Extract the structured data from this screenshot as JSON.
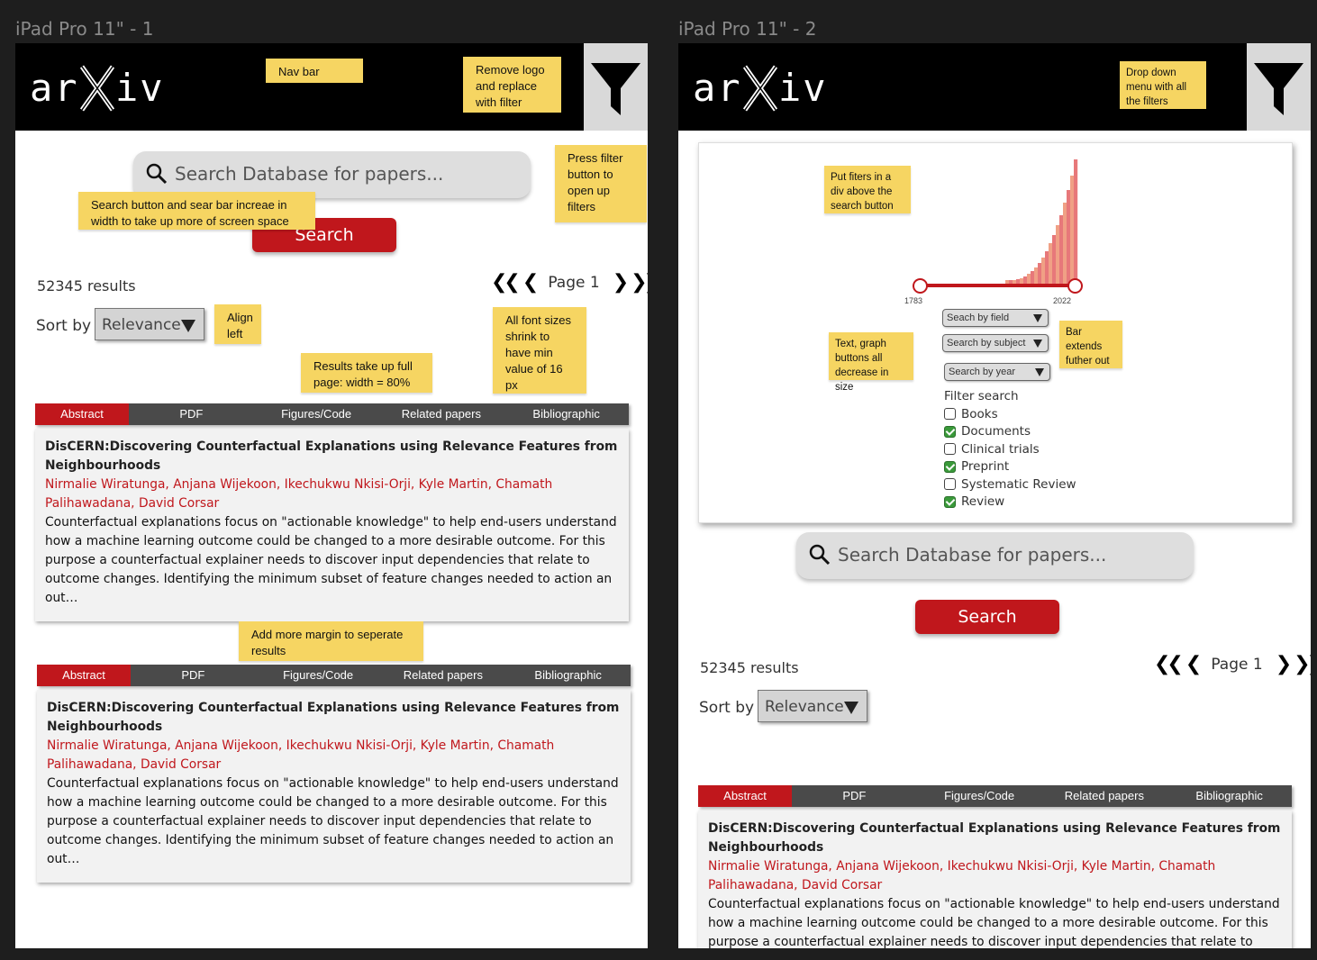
{
  "frames": [
    {
      "label": "iPad Pro 11\" - 1",
      "search": {
        "placeholder": "Search Database for papers...",
        "button": "Search"
      },
      "results_count": "52345 results",
      "pager": {
        "first": "«",
        "prev": "‹",
        "page_label": "Page 1",
        "next": "›",
        "last": "»"
      },
      "sort": {
        "label": "Sort by",
        "value": "Relevance"
      },
      "notes": {
        "nav_bar": "Nav bar",
        "remove_logo": "Remove logo and replace with filter",
        "press_filter": "Press filter button to open up filters",
        "search_width": "Search button and sear bar increae in width to take up more of screen space",
        "align_left": "Align left",
        "results_full": "Results take up full page: width = 80%",
        "font_sizes": "All font sizes shrink to have min value of 16 px",
        "margin": "Add more margin to seperate results"
      }
    },
    {
      "label": "iPad Pro 11\" - 2",
      "search": {
        "placeholder": "Search Database for papers...",
        "button": "Search"
      },
      "results_count": "52345 results",
      "pager": {
        "first": "«",
        "prev": "‹",
        "page_label": "Page 1",
        "next": "›",
        "last": "»"
      },
      "sort": {
        "label": "Sort by",
        "value": "Relevance"
      },
      "notes": {
        "dropdown": "Drop down menu with all the filters",
        "put_filters": "Put fiters in a div above the search button",
        "text_graph": "Text, graph buttons all decrease in size",
        "bar_extends": "Bar extends futher out"
      },
      "filters": {
        "year_min": "1783",
        "year_max": "2022",
        "selects": [
          "Seach by field",
          "Search by subject",
          "Search by year"
        ],
        "filter_header": "Filter search",
        "options": [
          {
            "label": "Books",
            "checked": false
          },
          {
            "label": "Documents",
            "checked": true
          },
          {
            "label": "Clinical trials",
            "checked": false
          },
          {
            "label": "Preprint",
            "checked": true
          },
          {
            "label": "Systematic Review",
            "checked": false
          },
          {
            "label": "Review",
            "checked": true
          }
        ]
      }
    }
  ],
  "tabs": [
    "Abstract",
    "PDF",
    "Figures/Code",
    "Related papers",
    "Bibliographic"
  ],
  "result": {
    "title": "DisCERN:Discovering Counterfactual Explanations using Relevance Features from Neighbourhoods",
    "authors": "Nirmalie Wiratunga, Anjana Wijekoon, Ikechukwu Nkisi-Orji, Kyle Martin, Chamath Palihawadana, David Corsar",
    "abstract": "Counterfactual explanations focus on \"actionable knowledge\" to help end-users understand how a machine learning outcome could be changed to a more desirable outcome. For this purpose a counterfactual explainer needs to discover input dependencies that relate to outcome changes. Identifying the minimum subset of feature changes needed to action an out…"
  },
  "icons": {
    "logo": "arxiv-logo",
    "filter": "funnel-icon",
    "search": "magnifier-icon"
  },
  "colors": {
    "accent": "#c0171c",
    "note": "#f6d562",
    "nav": "#000000",
    "tab_bar": "#4a4a4a"
  }
}
